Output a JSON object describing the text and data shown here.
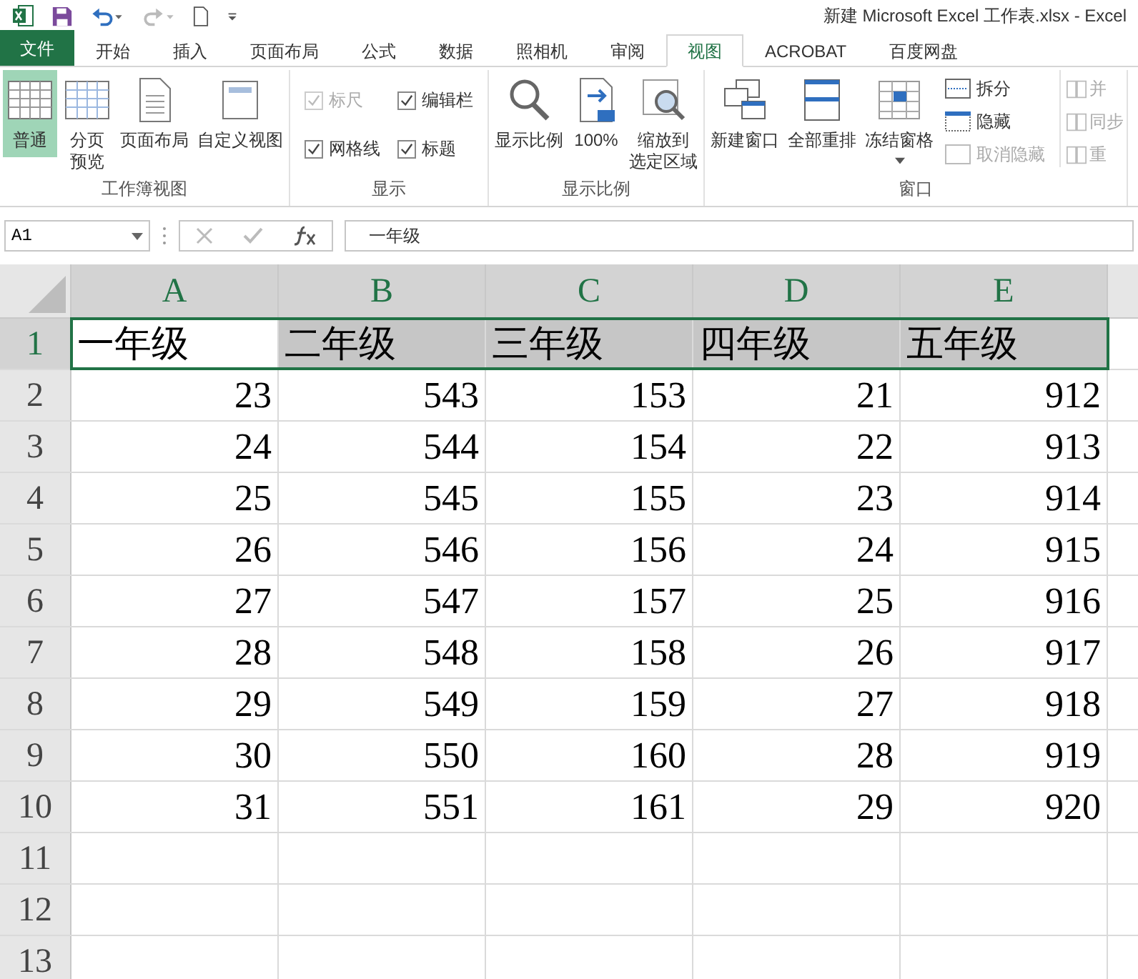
{
  "window": {
    "title": "新建 Microsoft Excel 工作表.xlsx - Excel"
  },
  "tabs": [
    {
      "label": "文件",
      "kind": "file",
      "selected": false
    },
    {
      "label": "开始",
      "kind": "tab",
      "selected": false
    },
    {
      "label": "插入",
      "kind": "tab",
      "selected": false
    },
    {
      "label": "页面布局",
      "kind": "tab",
      "selected": false
    },
    {
      "label": "公式",
      "kind": "tab",
      "selected": false
    },
    {
      "label": "数据",
      "kind": "tab",
      "selected": false
    },
    {
      "label": "照相机",
      "kind": "tab",
      "selected": false
    },
    {
      "label": "审阅",
      "kind": "tab",
      "selected": false
    },
    {
      "label": "视图",
      "kind": "tab",
      "selected": true
    },
    {
      "label": "ACROBAT",
      "kind": "tab",
      "selected": false
    },
    {
      "label": "百度网盘",
      "kind": "tab",
      "selected": false
    }
  ],
  "ribbon": {
    "workbook_views": {
      "label": "工作簿视图",
      "buttons": [
        {
          "lines": [
            "普通"
          ],
          "selected": true
        },
        {
          "lines": [
            "分页",
            "预览"
          ],
          "selected": false
        },
        {
          "lines": [
            "页面布局"
          ],
          "selected": false
        },
        {
          "lines": [
            "自定义视图"
          ],
          "selected": false
        }
      ]
    },
    "show": {
      "label": "显示",
      "checkboxes": [
        {
          "label": "标尺",
          "checked": true,
          "disabled": true
        },
        {
          "label": "编辑栏",
          "checked": true,
          "disabled": false
        },
        {
          "label": "网格线",
          "checked": true,
          "disabled": false
        },
        {
          "label": "标题",
          "checked": true,
          "disabled": false
        }
      ]
    },
    "zoom": {
      "label": "显示比例",
      "buttons": [
        {
          "lines": [
            "显示比例"
          ]
        },
        {
          "lines": [
            "100%"
          ]
        },
        {
          "lines": [
            "缩放到",
            "选定区域"
          ]
        }
      ]
    },
    "window": {
      "label": "窗口",
      "buttons": [
        {
          "lines": [
            "新建窗口"
          ],
          "dropdown": false
        },
        {
          "lines": [
            "全部重排"
          ],
          "dropdown": false
        },
        {
          "lines": [
            "冻结窗格"
          ],
          "dropdown": true
        }
      ],
      "small_buttons": [
        {
          "label": "拆分",
          "disabled": false
        },
        {
          "label": "隐藏",
          "disabled": false
        },
        {
          "label": "取消隐藏",
          "disabled": true
        }
      ],
      "cut_buttons": [
        {
          "label": "并",
          "disabled": true
        },
        {
          "label": "同步",
          "disabled": true
        },
        {
          "label": "重",
          "disabled": true
        }
      ]
    }
  },
  "formula_bar": {
    "name_box": "A1",
    "formula": "一年级"
  },
  "sheet": {
    "columns": [
      {
        "label": "A",
        "selected": true
      },
      {
        "label": "B",
        "selected": true
      },
      {
        "label": "C",
        "selected": true
      },
      {
        "label": "D",
        "selected": true
      },
      {
        "label": "E",
        "selected": true
      }
    ],
    "rows": [
      {
        "label": "1",
        "selected": true,
        "cells": [
          "一年级",
          "二年级",
          "三年级",
          "四年级",
          "五年级"
        ]
      },
      {
        "label": "2",
        "selected": false,
        "cells": [
          "23",
          "543",
          "153",
          "21",
          "912"
        ]
      },
      {
        "label": "3",
        "selected": false,
        "cells": [
          "24",
          "544",
          "154",
          "22",
          "913"
        ]
      },
      {
        "label": "4",
        "selected": false,
        "cells": [
          "25",
          "545",
          "155",
          "23",
          "914"
        ]
      },
      {
        "label": "5",
        "selected": false,
        "cells": [
          "26",
          "546",
          "156",
          "24",
          "915"
        ]
      },
      {
        "label": "6",
        "selected": false,
        "cells": [
          "27",
          "547",
          "157",
          "25",
          "916"
        ]
      },
      {
        "label": "7",
        "selected": false,
        "cells": [
          "28",
          "548",
          "158",
          "26",
          "917"
        ]
      },
      {
        "label": "8",
        "selected": false,
        "cells": [
          "29",
          "549",
          "159",
          "27",
          "918"
        ]
      },
      {
        "label": "9",
        "selected": false,
        "cells": [
          "30",
          "550",
          "160",
          "28",
          "919"
        ]
      },
      {
        "label": "10",
        "selected": false,
        "cells": [
          "31",
          "551",
          "161",
          "29",
          "920"
        ]
      },
      {
        "label": "11",
        "selected": false
      },
      {
        "label": "12",
        "selected": false
      },
      {
        "label": "13",
        "selected": false
      }
    ]
  }
}
